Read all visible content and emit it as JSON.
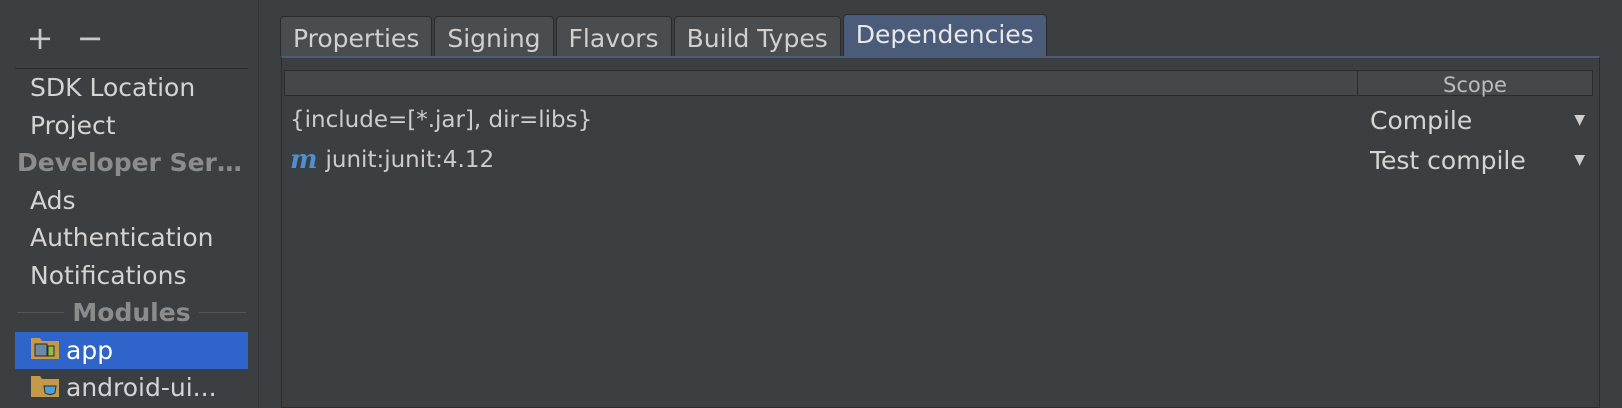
{
  "toolbar": {
    "add": "+",
    "remove": "−"
  },
  "sidebar": {
    "items": [
      "SDK Location",
      "Project"
    ],
    "section_developer": "Developer Servi...",
    "services": [
      "Ads",
      "Authentication",
      "Notifications"
    ],
    "section_modules": "Modules",
    "modules": [
      {
        "label": "app",
        "selected": true
      },
      {
        "label": "android-ui..."
      }
    ]
  },
  "tabs": [
    "Properties",
    "Signing",
    "Flavors",
    "Build Types",
    "Dependencies"
  ],
  "active_tab": "Dependencies",
  "table": {
    "scope_header": "Scope",
    "rows": [
      {
        "dependency": "{include=[*.jar], dir=libs}",
        "scope": "Compile"
      },
      {
        "dependency": "junit:junit:4.12",
        "icon": "m",
        "scope": "Test compile"
      }
    ]
  },
  "colors": {
    "selection": "#2f65ca",
    "active_tab": "#4a5c7a",
    "background": "#3c3f41",
    "maven_icon": "#4f8fcc"
  }
}
